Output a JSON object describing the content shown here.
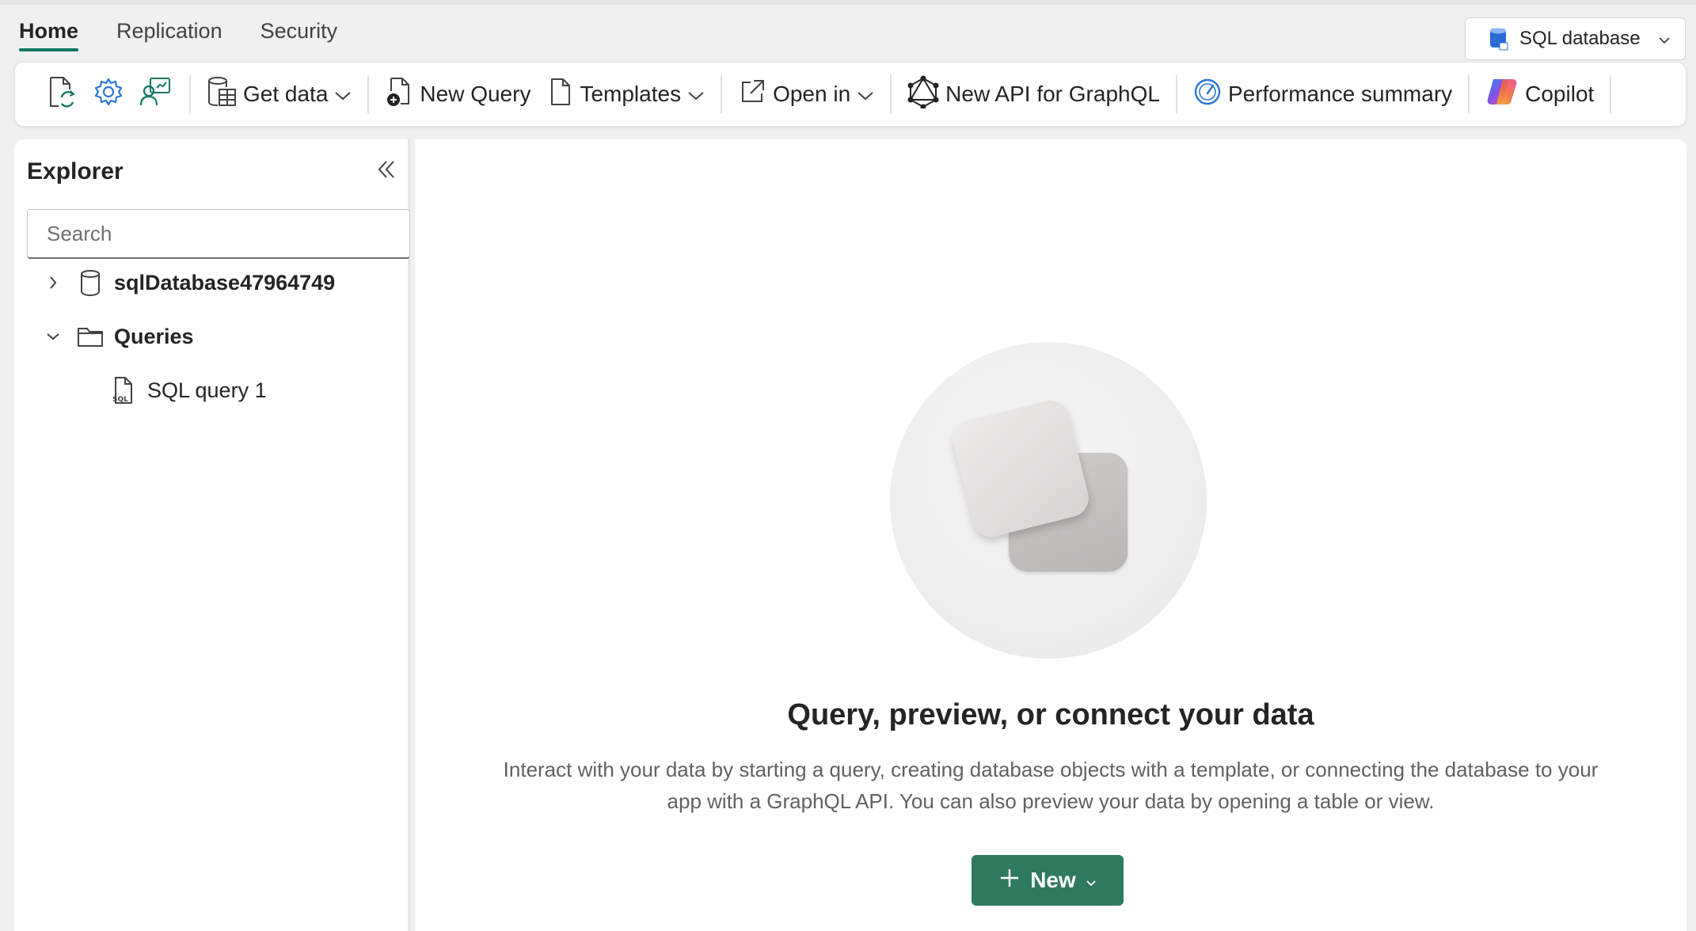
{
  "tabs": [
    {
      "label": "Home",
      "active": true
    },
    {
      "label": "Replication",
      "active": false
    },
    {
      "label": "Security",
      "active": false
    }
  ],
  "switcher": {
    "label": "SQL database",
    "icon": "sql-database-icon"
  },
  "toolbar": {
    "icon_buttons": [
      "refresh-icon",
      "settings-icon",
      "feedback-icon"
    ],
    "get_data": "Get data",
    "new_query": "New Query",
    "templates": "Templates",
    "open_in": "Open in",
    "new_api": "New API for GraphQL",
    "performance": "Performance summary",
    "copilot": "Copilot"
  },
  "explorer": {
    "title": "Explorer",
    "search_placeholder": "Search",
    "items": [
      {
        "label": "sqlDatabase47964749",
        "icon": "database-icon",
        "expanded": false
      },
      {
        "label": "Queries",
        "icon": "folder-icon",
        "expanded": true
      },
      {
        "label": "SQL query 1",
        "icon": "sql-file-icon"
      }
    ]
  },
  "main": {
    "title": "Query, preview, or connect your data",
    "description_line1": "Interact with your data by starting a query, creating database objects with a template, or connecting the database to your",
    "description_line2": "app with a GraphQL API. You can also preview your data by opening a table or view.",
    "new_button": "New"
  },
  "colors": {
    "accent": "#117865",
    "primary_button": "#2f7a5c"
  }
}
